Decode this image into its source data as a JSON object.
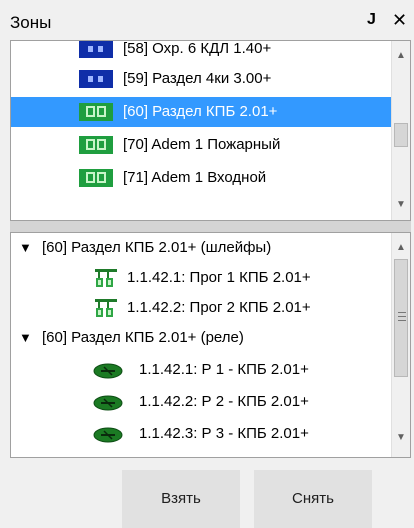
{
  "window": {
    "title": "Зоны",
    "pin_icon": "pin-icon",
    "close_icon": "close-icon"
  },
  "colors": {
    "selected_bg": "#3399ff",
    "zone_blue": "#0f2ea8",
    "zone_green": "#1f9e3f",
    "relay_green": "#1b7a23"
  },
  "zones": [
    {
      "label": "[58] Охр. 6 КДЛ 1.40+",
      "icon": "zone-blue-icon",
      "selected": false
    },
    {
      "label": "[59] Раздел 4ки 3.00+",
      "icon": "zone-blue-icon",
      "selected": false
    },
    {
      "label": "[60] Раздел КПБ 2.01+",
      "icon": "zone-green-icon",
      "selected": true
    },
    {
      "label": "[70] Adem 1 Пожарный",
      "icon": "zone-green-icon",
      "selected": false
    },
    {
      "label": "[71] Adem 1 Входной",
      "icon": "zone-green-icon",
      "selected": false
    }
  ],
  "details": {
    "loops_group": {
      "label": "[60] Раздел КПБ 2.01+ (шлейфы)",
      "items": [
        {
          "label": "1.1.42.1: Прог 1 КПБ 2.01+"
        },
        {
          "label": "1.1.42.2: Прог 2 КПБ 2.01+"
        }
      ]
    },
    "relays_group": {
      "label": "[60] Раздел КПБ 2.01+ (реле)",
      "items": [
        {
          "label": "1.1.42.1: Р 1 - КПБ 2.01+"
        },
        {
          "label": "1.1.42.2: Р 2 - КПБ 2.01+"
        },
        {
          "label": "1.1.42.3: Р 3 - КПБ 2.01+"
        }
      ]
    }
  },
  "buttons": {
    "take": "Взять",
    "remove": "Снять"
  }
}
